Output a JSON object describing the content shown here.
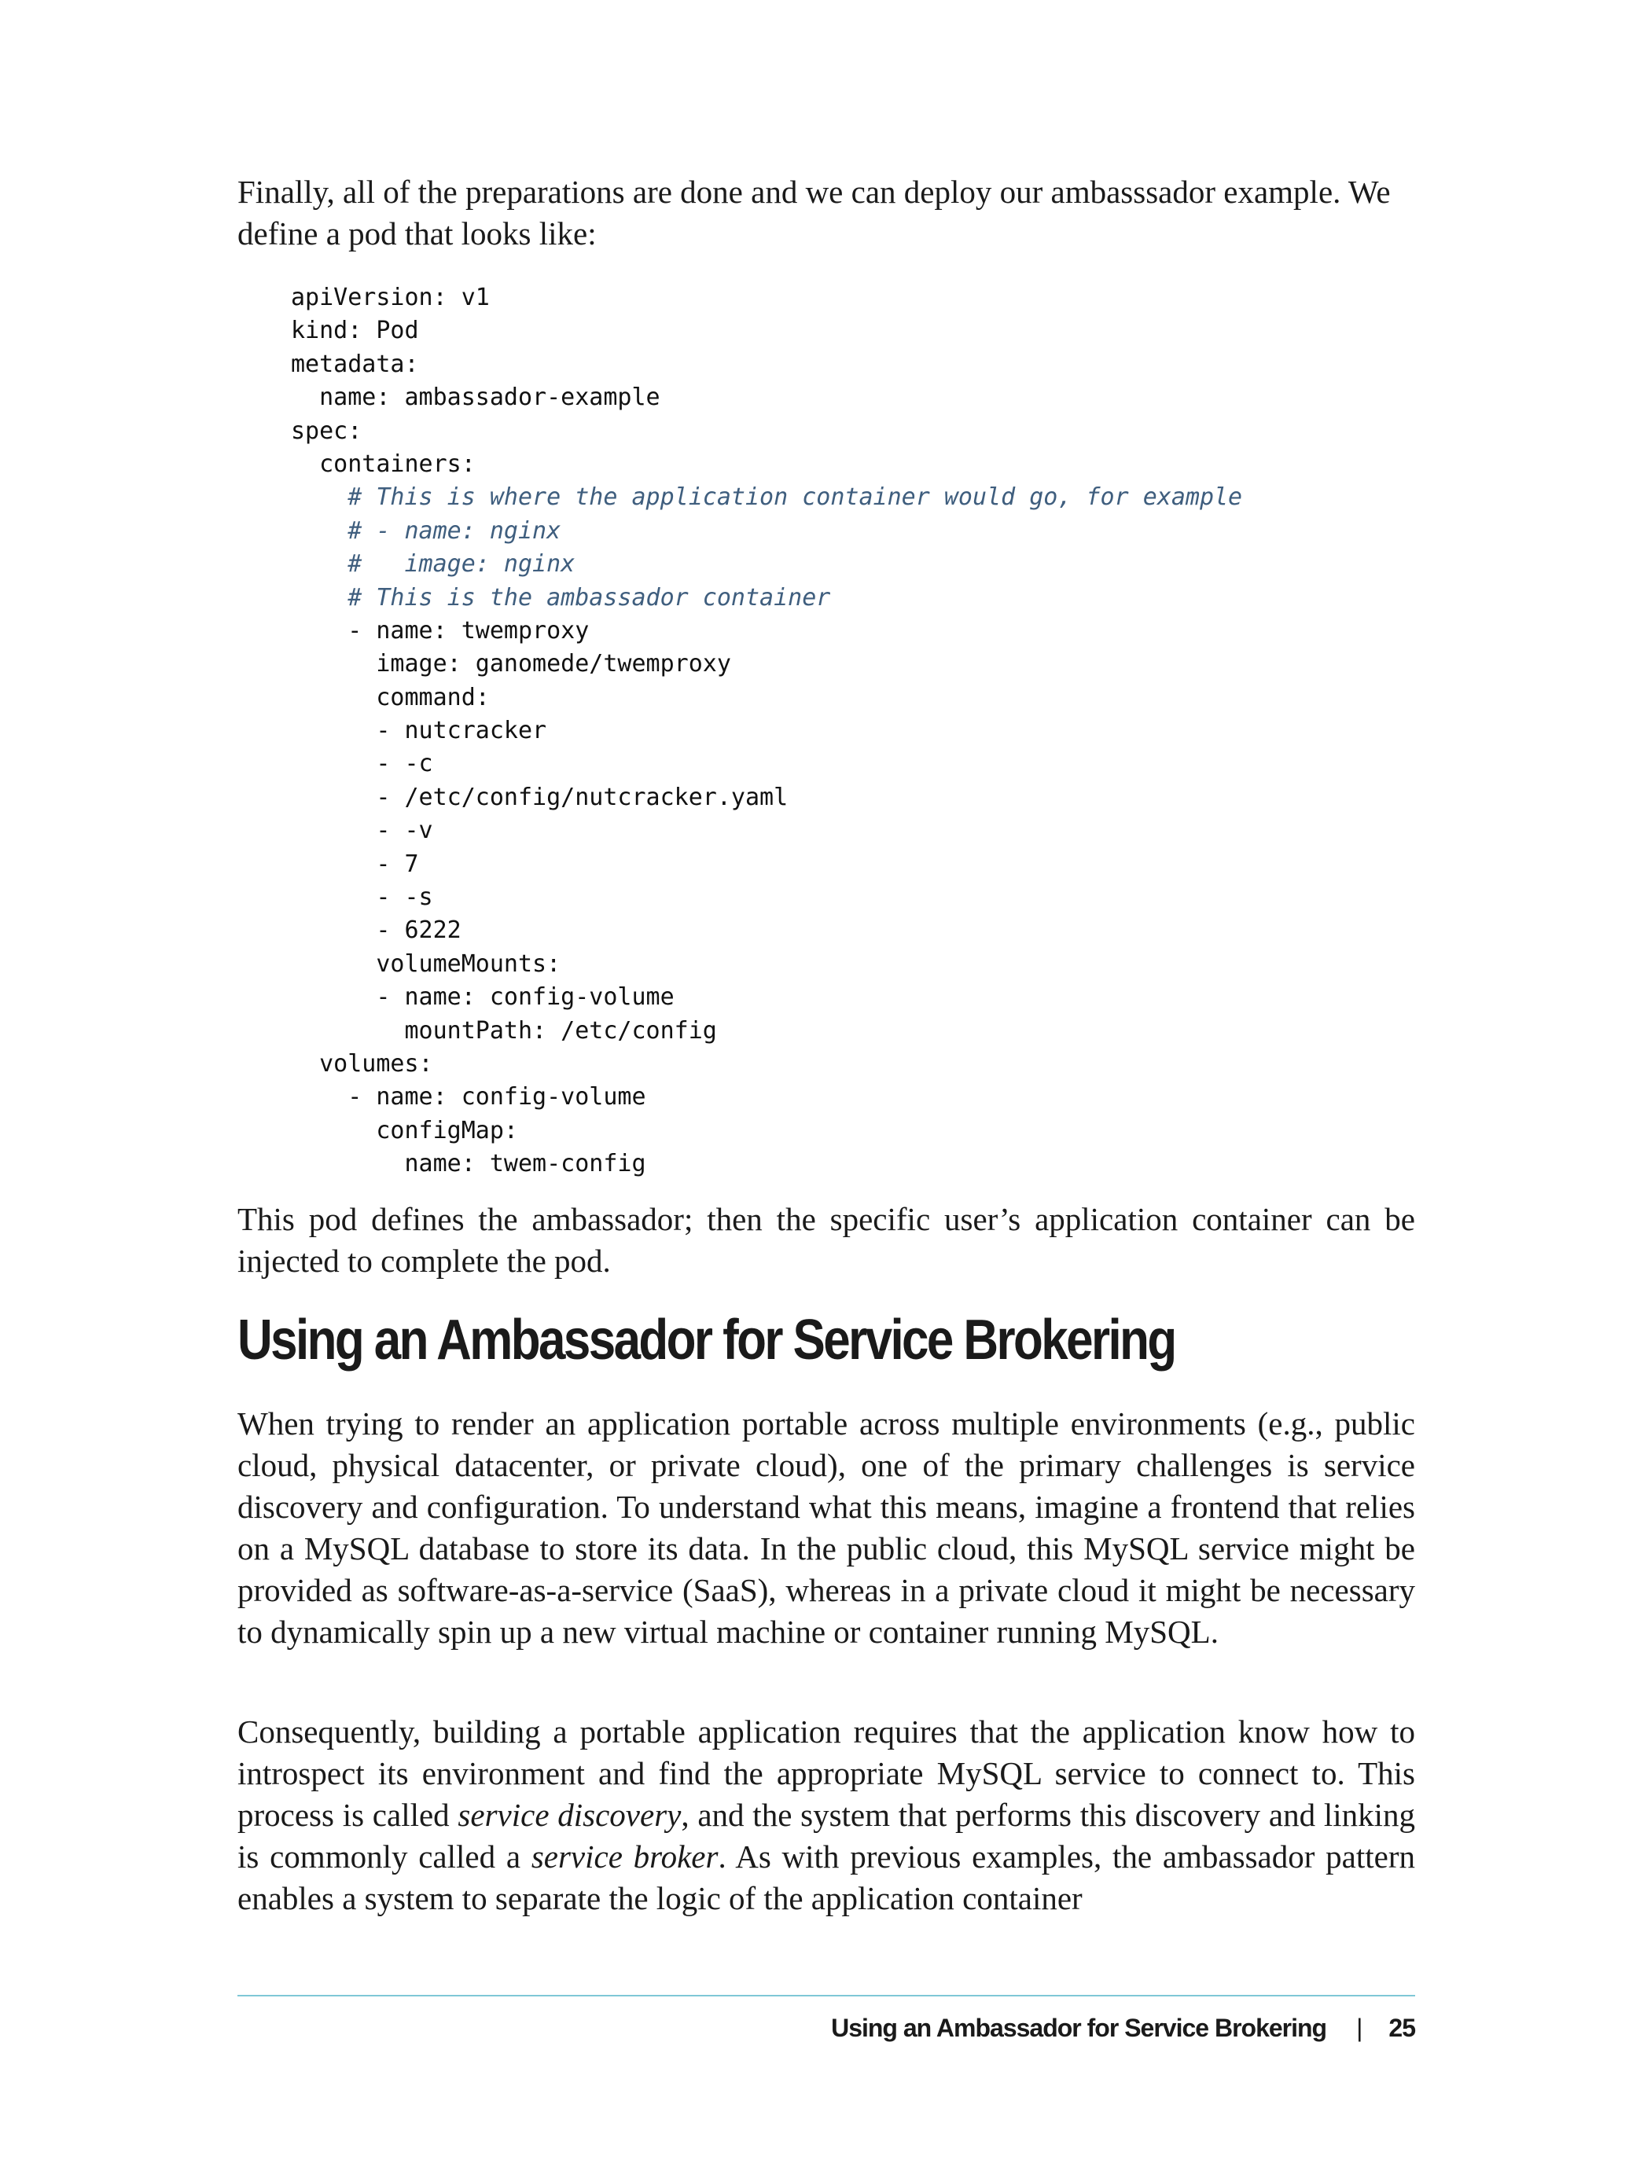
{
  "intro_paragraph": "Finally, all of the preparations are done and we can deploy our ambasssador example. We define a pod that looks like:",
  "code_lines": [
    {
      "text": "apiVersion: v1",
      "type": "code"
    },
    {
      "text": "kind: Pod",
      "type": "code"
    },
    {
      "text": "metadata:",
      "type": "code"
    },
    {
      "text": "  name: ambassador-example",
      "type": "code"
    },
    {
      "text": "spec:",
      "type": "code"
    },
    {
      "text": "  containers:",
      "type": "code"
    },
    {
      "text": "    # This is where the application container would go, for example",
      "type": "comment"
    },
    {
      "text": "    # - name: nginx",
      "type": "comment"
    },
    {
      "text": "    #   image: nginx",
      "type": "comment"
    },
    {
      "text": "    # This is the ambassador container",
      "type": "comment"
    },
    {
      "text": "    - name: twemproxy",
      "type": "code"
    },
    {
      "text": "      image: ganomede/twemproxy",
      "type": "code"
    },
    {
      "text": "      command:",
      "type": "code"
    },
    {
      "text": "      - nutcracker",
      "type": "code"
    },
    {
      "text": "      - -c",
      "type": "code"
    },
    {
      "text": "      - /etc/config/nutcracker.yaml",
      "type": "code"
    },
    {
      "text": "      - -v",
      "type": "code"
    },
    {
      "text": "      - 7",
      "type": "code"
    },
    {
      "text": "      - -s",
      "type": "code"
    },
    {
      "text": "      - 6222",
      "type": "code"
    },
    {
      "text": "      volumeMounts:",
      "type": "code"
    },
    {
      "text": "      - name: config-volume",
      "type": "code"
    },
    {
      "text": "        mountPath: /etc/config",
      "type": "code"
    },
    {
      "text": "  volumes:",
      "type": "code"
    },
    {
      "text": "    - name: config-volume",
      "type": "code"
    },
    {
      "text": "      configMap:",
      "type": "code"
    },
    {
      "text": "        name: twem-config",
      "type": "code"
    }
  ],
  "after_code_paragraph": "This pod defines the ambassador; then the specific user’s application container can be injected to complete the pod.",
  "section_title": "Using an Ambassador for Service Brokering",
  "paragraph_1": "When trying to render an application portable across multiple environments (e.g., public cloud, physical datacenter, or private cloud), one of the primary challenges is service discovery and configuration. To understand what this means, imagine a front­end that relies on a MySQL database to store its data. In the public cloud, this MySQL service might be provided as software-as-a-service (SaaS), whereas in a private cloud it might be necessary to dynamically spin up a new virtual machine or container run­ning MySQL.",
  "paragraph_2": {
    "part1": "Consequently, building a portable application requires that the application know how to introspect its environment and find the appropriate MySQL service to connect to. This process is called ",
    "term1": "service discovery",
    "part2": ", and the system that performs this discovery and linking is commonly called a ",
    "term2": "service broker",
    "part3": ". As with previous examples, the ambassador pattern enables a system to separate the logic of the application container"
  },
  "footer": {
    "running_title": "Using an Ambassador for Service Brokering",
    "separator": "|",
    "page_number": "25"
  }
}
